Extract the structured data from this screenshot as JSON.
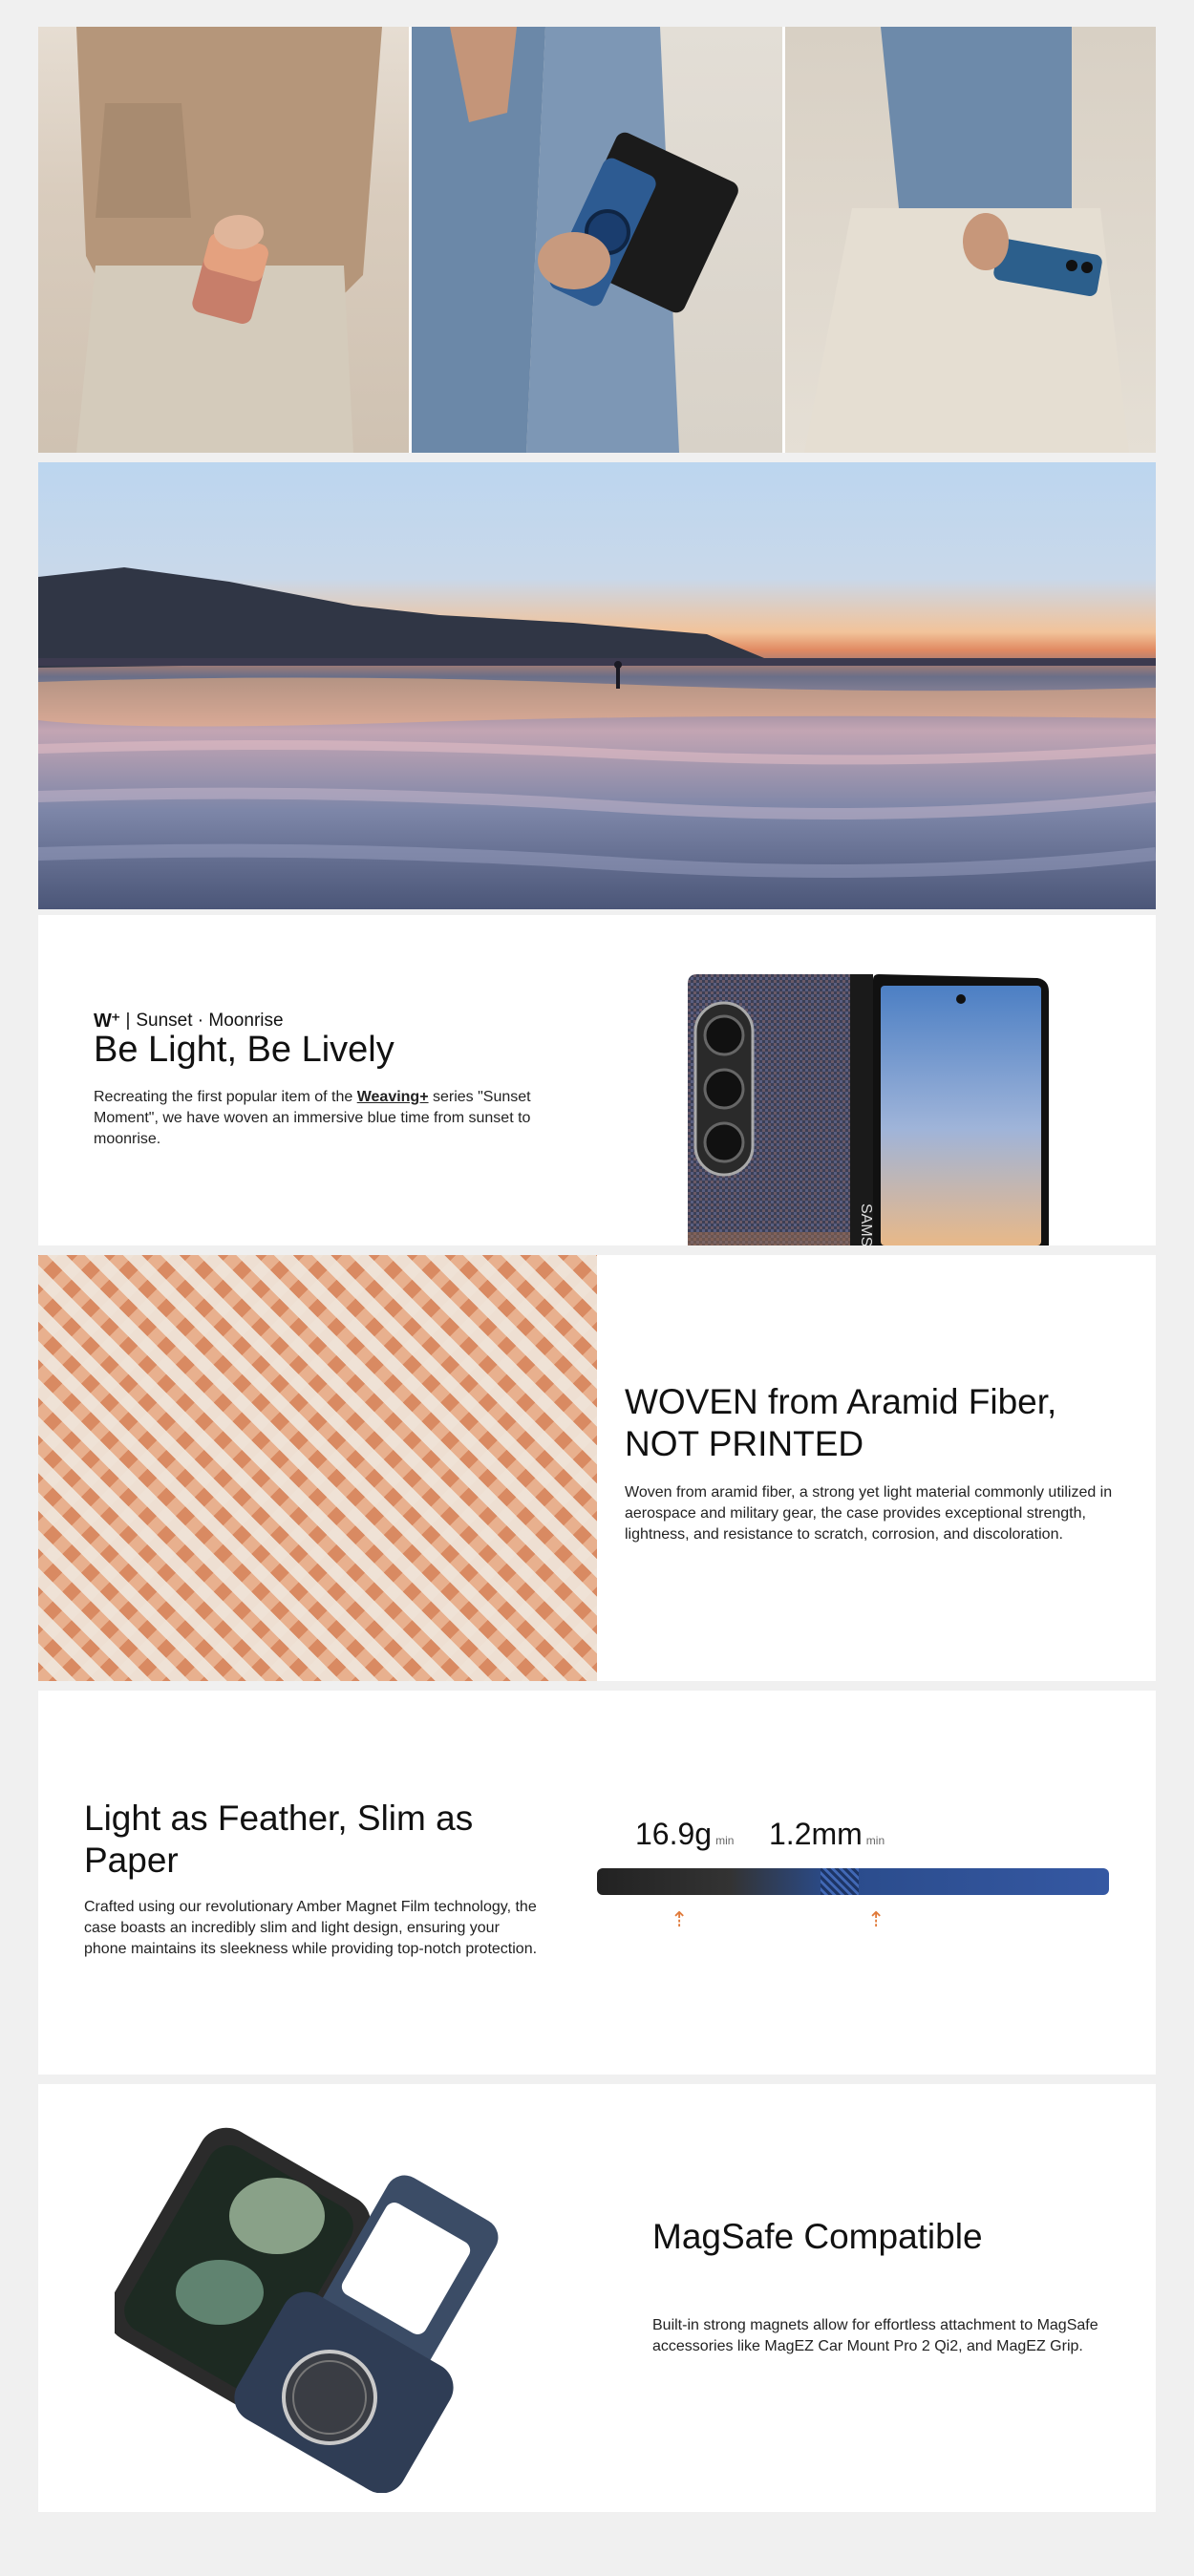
{
  "sections": {
    "belight": {
      "tagline_logo": "W⁺",
      "tagline": "Sunset · Moonrise",
      "title": "Be Light, Be Lively",
      "para_prefix": "Recreating the first popular item of the",
      "para_link": "Weaving+",
      "para_suffix": "series \"Sunset Moment\", we have woven an immersive blue time from sunset to moonrise."
    },
    "woven": {
      "title": "WOVEN from Aramid Fiber, NOT PRINTED",
      "para": "Woven from aramid fiber, a strong yet light material commonly utilized in aerospace and military gear, the case provides exceptional strength, lightness, and resistance to scratch, corrosion, and discoloration."
    },
    "feather": {
      "title": "Light as Feather, Slim as Paper",
      "para": "Crafted using our revolutionary Amber Magnet Film technology, the case boasts an incredibly slim and light design, ensuring your phone maintains its sleekness while providing top-notch protection.",
      "weight_value": "16.9g",
      "weight_unit": "min",
      "thickness_value": "1.2mm",
      "thickness_unit": "min",
      "arrow_symbol": "⇡"
    },
    "magsafe": {
      "title": "MagSafe Compatible",
      "para": "Built-in strong magnets allow for effortless attachment to MagSafe accessories like MagEZ Car Mount Pro 2 Qi2, and MagEZ Grip."
    },
    "phone_brand": "SAMSUNG"
  },
  "colors": {
    "page_bg": "#f0f0f0",
    "accent_arrow": "#e07a3a",
    "fiber_blue": "#3558a3"
  }
}
